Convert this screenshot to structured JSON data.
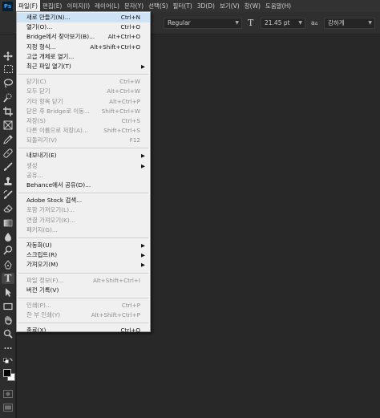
{
  "menubar": {
    "logo": "Ps",
    "items": [
      "파일(F)",
      "편집(E)",
      "이미지(I)",
      "레이어(L)",
      "문자(Y)",
      "선택(S)",
      "필터(T)",
      "3D(D)",
      "보기(V)",
      "창(W)",
      "도움말(H)"
    ]
  },
  "options": {
    "font_style": "Regular",
    "size_icon": "font-size-icon",
    "font_size": "21.45 pt",
    "aa_icon": "antialias-icon",
    "aa_glyph": "a",
    "antialias": "강하게",
    "type_glyph": "T"
  },
  "toolbar": {
    "type_glyph": "T",
    "type_tool_active": true,
    "foreground_color": "#000000",
    "background_color": "#ffffff"
  },
  "file_menu": {
    "groups": [
      [
        {
          "label": "새로 만들기(N)...",
          "shortcut": "Ctrl+N"
        },
        {
          "label": "열기(O)...",
          "shortcut": "Ctrl+O"
        },
        {
          "label": "Bridge에서 찾아보기(B)...",
          "shortcut": "Alt+Ctrl+O"
        },
        {
          "label": "지정 형식...",
          "shortcut": "Alt+Shift+Ctrl+O"
        },
        {
          "label": "고급 개체로 열기...",
          "shortcut": ""
        },
        {
          "label": "최근 파일 열기(T)",
          "shortcut": "",
          "submenu": true
        }
      ],
      [
        {
          "label": "닫기(C)",
          "shortcut": "Ctrl+W",
          "disabled": true
        },
        {
          "label": "모두 닫기",
          "shortcut": "Alt+Ctrl+W",
          "disabled": true
        },
        {
          "label": "기타 항목 닫기",
          "shortcut": "Alt+Ctrl+P",
          "disabled": true
        },
        {
          "label": "닫은 후 Bridge로 이동...",
          "shortcut": "Shift+Ctrl+W",
          "disabled": true
        },
        {
          "label": "저장(S)",
          "shortcut": "Ctrl+S",
          "disabled": true
        },
        {
          "label": "다른 이름으로 저장(A)...",
          "shortcut": "Shift+Ctrl+S",
          "disabled": true
        },
        {
          "label": "되돌리기(V)",
          "shortcut": "F12",
          "disabled": true
        }
      ],
      [
        {
          "label": "내보내기(E)",
          "shortcut": "",
          "submenu": true
        },
        {
          "label": "생성",
          "shortcut": "",
          "submenu": true,
          "disabled": true
        },
        {
          "label": "공유...",
          "shortcut": "",
          "disabled": true
        },
        {
          "label": "Behance에서 공유(D)...",
          "shortcut": ""
        }
      ],
      [
        {
          "label": "Adobe Stock 검색...",
          "shortcut": ""
        },
        {
          "label": "포함 가져오기(L)...",
          "shortcut": "",
          "disabled": true
        },
        {
          "label": "연결 가져오기(K)...",
          "shortcut": "",
          "disabled": true
        },
        {
          "label": "패키지(G)...",
          "shortcut": "",
          "disabled": true
        }
      ],
      [
        {
          "label": "자동화(U)",
          "shortcut": "",
          "submenu": true
        },
        {
          "label": "스크립트(R)",
          "shortcut": "",
          "submenu": true
        },
        {
          "label": "가져오기(M)",
          "shortcut": "",
          "submenu": true
        }
      ],
      [
        {
          "label": "파일 정보(F)...",
          "shortcut": "Alt+Shift+Ctrl+I",
          "disabled": true
        },
        {
          "label": "버전 기록(V)",
          "shortcut": ""
        }
      ],
      [
        {
          "label": "인쇄(P)...",
          "shortcut": "Ctrl+P",
          "disabled": true
        },
        {
          "label": "한 부 인쇄(Y)",
          "shortcut": "Alt+Shift+Ctrl+P",
          "disabled": true
        }
      ],
      [
        {
          "label": "종료(X)",
          "shortcut": "Ctrl+Q"
        }
      ]
    ]
  }
}
